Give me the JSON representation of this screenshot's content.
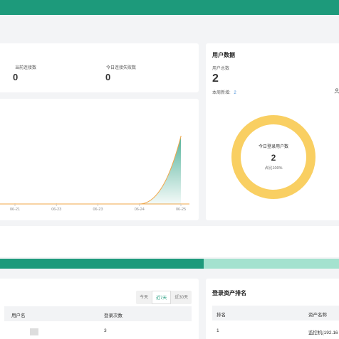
{
  "stats": {
    "current_connections_label": "当前连接数",
    "current_connections_value": "0",
    "today_failed_label": "今日连接失败数",
    "today_failed_value": "0"
  },
  "user_data": {
    "title": "用户数据",
    "total_label": "用户总数",
    "total_value": "2",
    "weekly_new_label": "本周新增:",
    "weekly_new_value": "2",
    "donut_label": "今日登录用户数",
    "donut_value": "2",
    "donut_ratio": "占比100%",
    "accent_color": "#f9cf62"
  },
  "chart_data": {
    "type": "area",
    "categories": [
      "06-21",
      "06-23",
      "06-23",
      "06-24",
      "06-25"
    ],
    "values": [
      0,
      0,
      0,
      0,
      2
    ],
    "color": "#1d9a7b",
    "title": "",
    "xlabel": "",
    "ylabel": ""
  },
  "progress": {
    "fraction": 0.6,
    "fill_color": "#1d9a7b",
    "track_color": "#a4e2cf"
  },
  "logins": {
    "tabs": [
      "今天",
      "近7天",
      "近30天"
    ],
    "active_tab": "近7天",
    "col_user": "用户名",
    "col_count": "登录次数",
    "rows": [
      {
        "count": "3"
      }
    ]
  },
  "assets": {
    "title": "登录资产排名",
    "col_rank": "排名",
    "col_name": "资产名称",
    "rows": [
      {
        "rank": "1",
        "name": "监控机(192.16"
      }
    ]
  }
}
